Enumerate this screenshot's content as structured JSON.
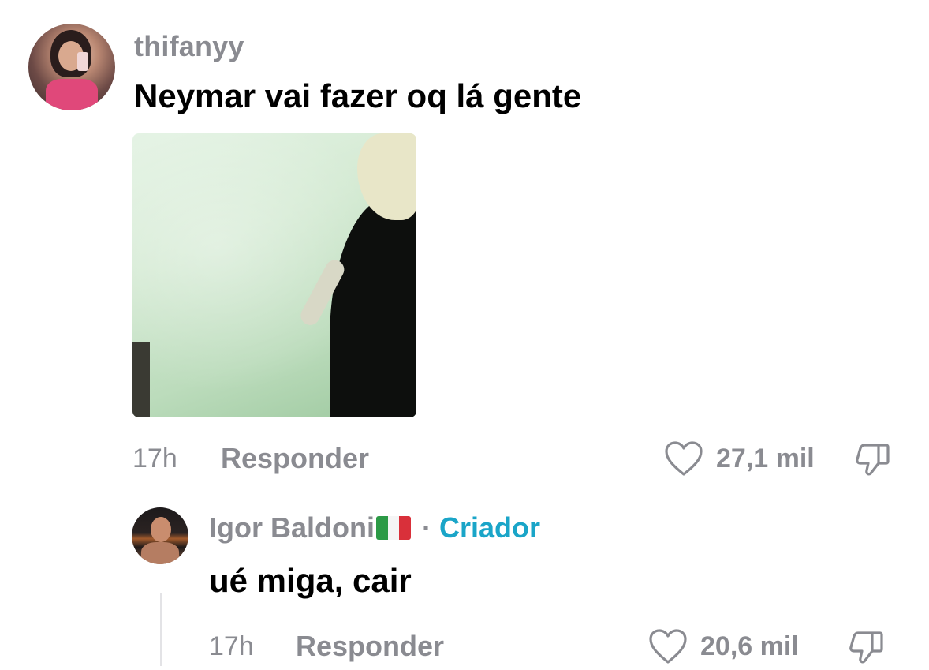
{
  "comment": {
    "username": "thifanyy",
    "text": "Neymar vai fazer oq lá gente",
    "time": "17h",
    "reply_label": "Responder",
    "like_count": "27,1 mil",
    "icons": {
      "like": "heart-outline-icon",
      "dislike": "thumbs-down-icon"
    }
  },
  "reply": {
    "username": "Igor Baldoni",
    "flag": "italy-flag",
    "separator": "·",
    "badge": "Criador",
    "text": "ué miga, cair",
    "time": "17h",
    "reply_label": "Responder",
    "like_count": "20,6 mil",
    "icons": {
      "like": "heart-outline-icon",
      "dislike": "thumbs-down-icon"
    }
  },
  "colors": {
    "muted_text": "#8a8b91",
    "primary_text": "#000000",
    "creator_accent": "#1aa5c8"
  }
}
